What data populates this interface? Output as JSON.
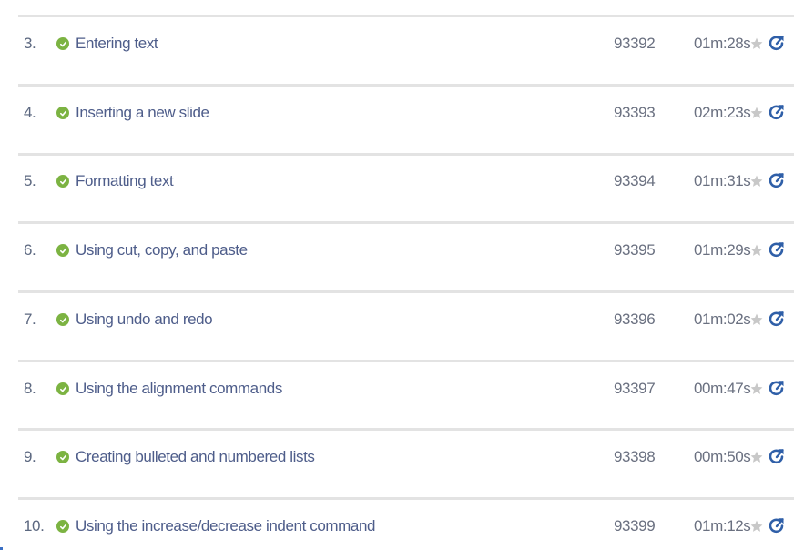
{
  "lessons": [
    {
      "num": "3.",
      "title": "Entering text",
      "id": "93392",
      "duration": "01m:28s"
    },
    {
      "num": "4.",
      "title": "Inserting a new slide",
      "id": "93393",
      "duration": "02m:23s"
    },
    {
      "num": "5.",
      "title": "Formatting text",
      "id": "93394",
      "duration": "01m:31s"
    },
    {
      "num": "6.",
      "title": "Using cut, copy, and paste",
      "id": "93395",
      "duration": "01m:29s"
    },
    {
      "num": "7.",
      "title": "Using undo and redo",
      "id": "93396",
      "duration": "01m:02s"
    },
    {
      "num": "8.",
      "title": "Using the alignment commands",
      "id": "93397",
      "duration": "00m:47s"
    },
    {
      "num": "9.",
      "title": "Creating bulleted and numbered lists",
      "id": "93398",
      "duration": "00m:50s"
    },
    {
      "num": "10.",
      "title": "Using the increase/decrease indent command",
      "id": "93399",
      "duration": "01m:12s"
    }
  ],
  "icons": {
    "status": "check-circle-icon",
    "favorite": "star-icon",
    "open": "open-external-icon"
  },
  "colors": {
    "check": "#7cb342",
    "title": "#4e5d8a",
    "star": "#c8c8c8",
    "open_icon": "#2f5fa8",
    "divider": "#e3e3e3"
  }
}
